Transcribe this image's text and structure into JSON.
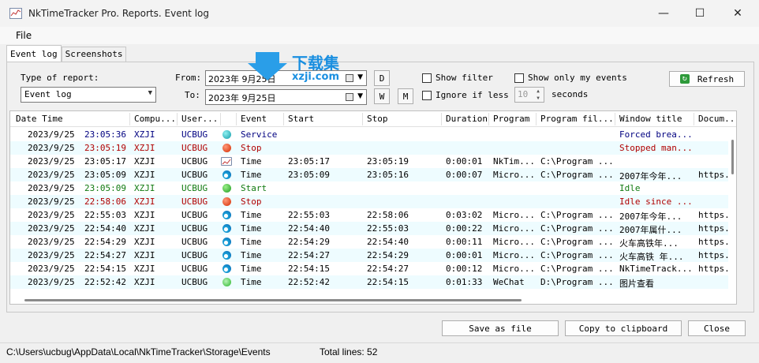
{
  "window": {
    "title": "NkTimeTracker Pro. Reports. Event log",
    "minimize": "—",
    "maximize": "☐",
    "close": "✕"
  },
  "menu": {
    "file": "File"
  },
  "tabs": [
    {
      "label": "Event log"
    },
    {
      "label": "Screenshots"
    }
  ],
  "filters": {
    "type_label": "Type of report:",
    "type_value": "Event log",
    "from_label": "From:",
    "from_value": "2023年  9月25日",
    "to_label": "To:",
    "to_value": "2023年  9月25日",
    "d_button": "D",
    "w_button": "W",
    "m_button": "M",
    "show_filter": "Show filter",
    "ignore_less": "Ignore if less than",
    "ignore_seconds": "10",
    "seconds_label": "seconds",
    "show_only_my": "Show only my events",
    "refresh": "Refresh"
  },
  "watermark": {
    "text": "下载集",
    "url": "xzji.com"
  },
  "columns": [
    "Date Time",
    "Compu...",
    "User...",
    "",
    "Event",
    "Start",
    "Stop",
    "Duration",
    "Program",
    "Program fil...",
    "Window title",
    "Docum..."
  ],
  "rows": [
    {
      "date": "2023/9/25",
      "time": "23:05:36",
      "comp": "XZJI",
      "user": "UCBUG",
      "icon": "cyan",
      "event": "Service",
      "start": "",
      "stop": "",
      "dur": "",
      "prog": "",
      "pfile": "",
      "wtitle": "Forced brea...",
      "doc": "",
      "color": "#000080"
    },
    {
      "date": "2023/9/25",
      "time": "23:05:19",
      "comp": "XZJI",
      "user": "UCBUG",
      "icon": "red",
      "event": "Stop",
      "start": "",
      "stop": "",
      "dur": "",
      "prog": "",
      "pfile": "",
      "wtitle": "Stopped man...",
      "doc": "",
      "color": "#b00000"
    },
    {
      "date": "2023/9/25",
      "time": "23:05:17",
      "comp": "XZJI",
      "user": "UCBUG",
      "icon": "chart",
      "event": "Time",
      "start": "23:05:17",
      "stop": "23:05:19",
      "dur": "0:00:01",
      "prog": "NkTim...",
      "pfile": "C:\\Program ...",
      "wtitle": "",
      "doc": "",
      "color": "#000000"
    },
    {
      "date": "2023/9/25",
      "time": "23:05:09",
      "comp": "XZJI",
      "user": "UCBUG",
      "icon": "edge",
      "event": "Time",
      "start": "23:05:09",
      "stop": "23:05:16",
      "dur": "0:00:07",
      "prog": "Micro...",
      "pfile": "C:\\Program ...",
      "wtitle": "2007年今年...",
      "doc": "https...",
      "color": "#000000"
    },
    {
      "date": "2023/9/25",
      "time": "23:05:09",
      "comp": "XZJI",
      "user": "UCBUG",
      "icon": "green",
      "event": "Start",
      "start": "",
      "stop": "",
      "dur": "",
      "prog": "",
      "pfile": "",
      "wtitle": "Idle",
      "doc": "",
      "color": "#107a10"
    },
    {
      "date": "2023/9/25",
      "time": "22:58:06",
      "comp": "XZJI",
      "user": "UCBUG",
      "icon": "red",
      "event": "Stop",
      "start": "",
      "stop": "",
      "dur": "",
      "prog": "",
      "pfile": "",
      "wtitle": "Idle since ...",
      "doc": "",
      "color": "#b00000"
    },
    {
      "date": "2023/9/25",
      "time": "22:55:03",
      "comp": "XZJI",
      "user": "UCBUG",
      "icon": "edge",
      "event": "Time",
      "start": "22:55:03",
      "stop": "22:58:06",
      "dur": "0:03:02",
      "prog": "Micro...",
      "pfile": "C:\\Program ...",
      "wtitle": "2007年今年...",
      "doc": "https...",
      "color": "#000000"
    },
    {
      "date": "2023/9/25",
      "time": "22:54:40",
      "comp": "XZJI",
      "user": "UCBUG",
      "icon": "edge",
      "event": "Time",
      "start": "22:54:40",
      "stop": "22:55:03",
      "dur": "0:00:22",
      "prog": "Micro...",
      "pfile": "C:\\Program ...",
      "wtitle": "2007年属什...",
      "doc": "https...",
      "color": "#000000"
    },
    {
      "date": "2023/9/25",
      "time": "22:54:29",
      "comp": "XZJI",
      "user": "UCBUG",
      "icon": "edge",
      "event": "Time",
      "start": "22:54:29",
      "stop": "22:54:40",
      "dur": "0:00:11",
      "prog": "Micro...",
      "pfile": "C:\\Program ...",
      "wtitle": "火车高铁年...",
      "doc": "https...",
      "color": "#000000"
    },
    {
      "date": "2023/9/25",
      "time": "22:54:27",
      "comp": "XZJI",
      "user": "UCBUG",
      "icon": "edge",
      "event": "Time",
      "start": "22:54:27",
      "stop": "22:54:29",
      "dur": "0:00:01",
      "prog": "Micro...",
      "pfile": "C:\\Program ...",
      "wtitle": "火车高铁 年...",
      "doc": "https...",
      "color": "#000000"
    },
    {
      "date": "2023/9/25",
      "time": "22:54:15",
      "comp": "XZJI",
      "user": "UCBUG",
      "icon": "edge",
      "event": "Time",
      "start": "22:54:15",
      "stop": "22:54:27",
      "dur": "0:00:12",
      "prog": "Micro...",
      "pfile": "C:\\Program ...",
      "wtitle": "NkTimeTrack...",
      "doc": "https...",
      "color": "#000000"
    },
    {
      "date": "2023/9/25",
      "time": "22:52:42",
      "comp": "XZJI",
      "user": "UCBUG",
      "icon": "wechat",
      "event": "Time",
      "start": "22:52:42",
      "stop": "22:54:15",
      "dur": "0:01:33",
      "prog": "WeChat",
      "pfile": "D:\\Program ...",
      "wtitle": "图片查看",
      "doc": "",
      "color": "#000000"
    }
  ],
  "buttons": {
    "save": "Save as file",
    "copy": "Copy to clipboard",
    "close": "Close"
  },
  "status": {
    "path": "C:\\Users\\ucbug\\AppData\\Local\\NkTimeTracker\\Storage\\Events",
    "total": "Total lines: 52"
  },
  "colors": {
    "link_blue": "#000080",
    "stop_red": "#b00000",
    "start_green": "#107a10",
    "row_alt": "#eefcff"
  }
}
